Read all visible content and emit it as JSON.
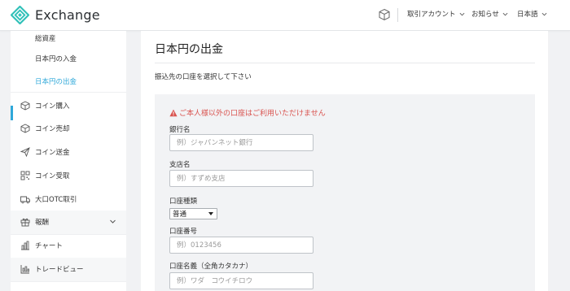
{
  "header": {
    "app_name": "Exchange",
    "menus": [
      {
        "label": "取引アカウント"
      },
      {
        "label": "お知らせ"
      },
      {
        "label": "日本語"
      }
    ]
  },
  "sidebar": {
    "items": [
      {
        "label": "総資産",
        "icon": "none"
      },
      {
        "label": "日本円の入金",
        "icon": "none"
      },
      {
        "label": "日本円の出金",
        "icon": "none",
        "active": true
      },
      {
        "label": "コイン購入",
        "icon": "cube-icon"
      },
      {
        "label": "コイン売却",
        "icon": "cube-icon"
      },
      {
        "label": "コイン送金",
        "icon": "send-icon"
      },
      {
        "label": "コイン受取",
        "icon": "qr-icon"
      },
      {
        "label": "大口OTC取引",
        "icon": "truck-icon"
      },
      {
        "label": "報酬",
        "icon": "gift-icon",
        "expandable": true
      },
      {
        "label": "チャート",
        "icon": "bar-chart-icon"
      },
      {
        "label": "トレードビュー",
        "icon": "trend-chart-icon"
      }
    ],
    "accent_color": "#2fa8d9"
  },
  "main": {
    "title": "日本円の出金",
    "subtitle": "振込先の口座を選択して下さい",
    "warning": "ご本人様以外の口座はご利用いただけません",
    "warning_color": "#d9534f",
    "form": {
      "bank_name": {
        "label": "銀行名",
        "placeholder": "例）ジャパンネット銀行",
        "value": ""
      },
      "branch_name": {
        "label": "支店名",
        "placeholder": "例）すずめ支店",
        "value": ""
      },
      "account_type": {
        "label": "口座種類",
        "selected": "普通"
      },
      "account_number": {
        "label": "口座番号",
        "placeholder": "例）0123456",
        "value": ""
      },
      "account_holder": {
        "label": "口座名義（全角カタカナ）",
        "placeholder": "例）ワダ　コウイチロウ",
        "value": ""
      }
    }
  }
}
